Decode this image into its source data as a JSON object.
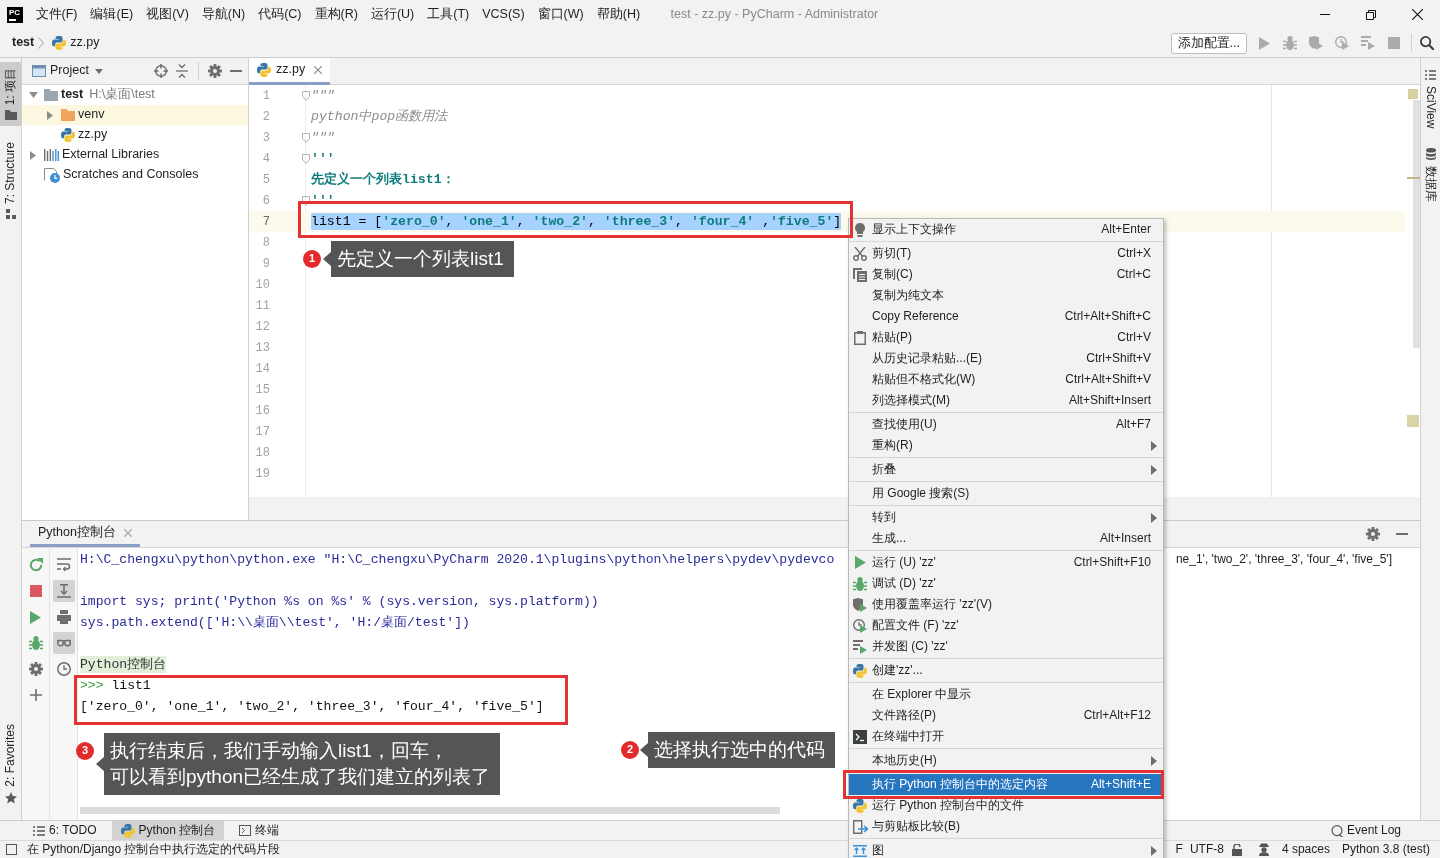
{
  "window": {
    "logo_text": "PC",
    "menu": [
      "文件(F)",
      "编辑(E)",
      "视图(V)",
      "导航(N)",
      "代码(C)",
      "重构(R)",
      "运行(U)",
      "工具(T)",
      "VCS(S)",
      "窗口(W)",
      "帮助(H)"
    ],
    "title": "test - zz.py - PyCharm - Administrator"
  },
  "navbar": {
    "breadcrumbs": [
      "test",
      "zz.py"
    ],
    "config_button": "添加配置...",
    "run_buttons_disabled": true
  },
  "left_strip": {
    "tabs": [
      {
        "label": "1: 项目",
        "selected": true
      },
      {
        "label": "7: Structure",
        "selected": false
      }
    ],
    "bottom_tabs": [
      {
        "label": "2: Favorites",
        "selected": false
      }
    ]
  },
  "project": {
    "title": "Project",
    "tree": [
      {
        "kind": "folder",
        "label": "test",
        "path": "H:\\桌面\\test",
        "expanded": true,
        "highlighted": false,
        "children": [
          {
            "kind": "excluded-folder",
            "label": "venv",
            "expanded": false,
            "highlighted": true
          },
          {
            "kind": "python-file",
            "label": "zz.py",
            "highlighted": false
          }
        ]
      },
      {
        "kind": "library",
        "label": "External Libraries",
        "expanded": false,
        "highlighted": false
      },
      {
        "kind": "scratches",
        "label": "Scratches and Consoles",
        "highlighted": false
      }
    ]
  },
  "editor": {
    "tabs": [
      {
        "label": "zz.py",
        "selected": true
      }
    ],
    "lines": [
      {
        "number": "1",
        "fold": true,
        "selected": false,
        "current": false,
        "tokens": [
          {
            "kind": "doc",
            "text": "\"\"\""
          }
        ]
      },
      {
        "number": "2",
        "fold": false,
        "selected": false,
        "current": false,
        "tokens": [
          {
            "kind": "doc",
            "text": "python中pop函数用法"
          }
        ]
      },
      {
        "number": "3",
        "fold": true,
        "selected": false,
        "current": false,
        "tokens": [
          {
            "kind": "doc",
            "text": "\"\"\""
          }
        ]
      },
      {
        "number": "4",
        "fold": true,
        "selected": false,
        "current": false,
        "tokens": [
          {
            "kind": "string",
            "text": "'''"
          }
        ]
      },
      {
        "number": "5",
        "fold": false,
        "selected": false,
        "current": false,
        "tokens": [
          {
            "kind": "string",
            "text": "先定义一个列表list1："
          }
        ]
      },
      {
        "number": "6",
        "fold": true,
        "selected": false,
        "current": false,
        "tokens": [
          {
            "kind": "string",
            "text": "'''"
          }
        ]
      },
      {
        "number": "7",
        "fold": false,
        "selected": true,
        "current": true,
        "tokens": [
          {
            "kind": "plain",
            "text": "list1 = ["
          },
          {
            "kind": "string",
            "text": "'zero_0'"
          },
          {
            "kind": "plain",
            "text": ", "
          },
          {
            "kind": "string",
            "text": "'one_1'"
          },
          {
            "kind": "plain",
            "text": ", "
          },
          {
            "kind": "string",
            "text": "'two_2'"
          },
          {
            "kind": "plain",
            "text": ", "
          },
          {
            "kind": "string",
            "text": "'three_3'"
          },
          {
            "kind": "plain",
            "text": ", "
          },
          {
            "kind": "string",
            "text": "'four_4'"
          },
          {
            "kind": "plain",
            "text": " ,"
          },
          {
            "kind": "string",
            "text": "'five_5'"
          },
          {
            "kind": "plain",
            "text": "]"
          }
        ]
      },
      {
        "number": "8",
        "fold": false,
        "selected": false,
        "current": false
      },
      {
        "number": "9",
        "fold": false,
        "selected": false,
        "current": false
      },
      {
        "number": "10",
        "fold": false,
        "selected": false,
        "current": false
      },
      {
        "number": "11",
        "fold": false,
        "selected": false,
        "current": false
      },
      {
        "number": "12",
        "fold": false,
        "selected": false,
        "current": false
      },
      {
        "number": "13",
        "fold": false,
        "selected": false,
        "current": false
      },
      {
        "number": "14",
        "fold": false,
        "selected": false,
        "current": false
      },
      {
        "number": "15",
        "fold": false,
        "selected": false,
        "current": false
      },
      {
        "number": "16",
        "fold": false,
        "selected": false,
        "current": false
      },
      {
        "number": "17",
        "fold": false,
        "selected": false,
        "current": false
      },
      {
        "number": "18",
        "fold": false,
        "selected": false,
        "current": false
      },
      {
        "number": "19",
        "fold": false,
        "selected": false,
        "current": false
      }
    ]
  },
  "context_menu": {
    "groups": [
      [
        {
          "label": "显示上下文操作",
          "shortcut": "Alt+Enter",
          "submenu": false,
          "selected": false
        }
      ],
      [
        {
          "label": "剪切(T)",
          "shortcut": "Ctrl+X",
          "submenu": false,
          "selected": false
        },
        {
          "label": "复制(C)",
          "shortcut": "Ctrl+C",
          "submenu": false,
          "selected": false
        },
        {
          "label": "复制为纯文本",
          "submenu": false,
          "selected": false
        },
        {
          "label": "Copy Reference",
          "shortcut": "Ctrl+Alt+Shift+C",
          "submenu": false,
          "selected": false
        },
        {
          "label": "粘贴(P)",
          "shortcut": "Ctrl+V",
          "submenu": false,
          "selected": false
        },
        {
          "label": "从历史记录粘贴...(E)",
          "shortcut": "Ctrl+Shift+V",
          "submenu": false,
          "selected": false
        },
        {
          "label": "粘贴但不格式化(W)",
          "shortcut": "Ctrl+Alt+Shift+V",
          "submenu": false,
          "selected": false
        },
        {
          "label": "列选择模式(M)",
          "shortcut": "Alt+Shift+Insert",
          "submenu": false,
          "selected": false
        }
      ],
      [
        {
          "label": "查找使用(U)",
          "shortcut": "Alt+F7",
          "submenu": false,
          "selected": false
        },
        {
          "label": "重构(R)",
          "submenu": true,
          "selected": false
        }
      ],
      [
        {
          "label": "折叠",
          "submenu": true,
          "selected": false
        }
      ],
      [
        {
          "label": "用 Google 搜索(S)",
          "submenu": false,
          "selected": false
        }
      ],
      [
        {
          "label": "转到",
          "submenu": true,
          "selected": false
        },
        {
          "label": "生成...",
          "shortcut": "Alt+Insert",
          "submenu": false,
          "selected": false
        }
      ],
      [
        {
          "label": "运行 (U) 'zz'",
          "shortcut": "Ctrl+Shift+F10",
          "submenu": false,
          "selected": false
        },
        {
          "label": "调试 (D) 'zz'",
          "submenu": false,
          "selected": false
        },
        {
          "label": "使用覆盖率运行 'zz'(V)",
          "submenu": false,
          "selected": false
        },
        {
          "label": "配置文件 (F) 'zz'",
          "submenu": false,
          "selected": false
        },
        {
          "label": "并发图 (C) 'zz'",
          "submenu": false,
          "selected": false
        }
      ],
      [
        {
          "label": "创建'zz'...",
          "submenu": false,
          "selected": false
        }
      ],
      [
        {
          "label": "在 Explorer 中显示",
          "submenu": false,
          "selected": false
        },
        {
          "label": "文件路径(P)",
          "shortcut": "Ctrl+Alt+F12",
          "submenu": false,
          "selected": false
        },
        {
          "label": "在终端中打开",
          "submenu": false,
          "selected": false
        }
      ],
      [
        {
          "label": "本地历史(H)",
          "submenu": true,
          "selected": false
        }
      ],
      [
        {
          "label": "执行 Python 控制台中的选定内容",
          "shortcut": "Alt+Shift+E",
          "submenu": false,
          "selected": true
        },
        {
          "label": "运行 Python 控制台中的文件",
          "submenu": false,
          "selected": false
        },
        {
          "label": "与剪贴板比较(B)",
          "submenu": false,
          "selected": false
        }
      ],
      [
        {
          "label": "图",
          "submenu": true,
          "selected": false
        }
      ]
    ]
  },
  "console": {
    "tabs": [
      {
        "label": "Python控制台",
        "selected": true
      }
    ],
    "tools": [
      {
        "on": false
      },
      {
        "on": true
      },
      {
        "on": false
      },
      {
        "on": true
      },
      {
        "on": false
      }
    ],
    "blocks": [
      [
        {
          "kind": "command",
          "text": "H:\\C_chengxu\\python\\python.exe \"H:\\C_chengxu\\PyCharm 2020.1\\plugins\\python\\helpers\\pydev\\pydevco"
        }
      ],
      [
        {
          "kind": "command",
          "text": "import sys; print('Python %s on %s' % (sys.version, sys.platform))"
        },
        {
          "kind": "command",
          "text": "sys.path.extend(['H:\\\\桌面\\\\test', 'H:/桌面/test'])"
        }
      ],
      [
        {
          "kind": "banner",
          "text": "Python控制台"
        },
        {
          "kind": "input",
          "prompt": ">>>",
          "text": "list1"
        },
        {
          "kind": "output",
          "text": "['zero_0', 'one_1', 'two_2', 'three_3', 'four_4', 'five_5']"
        }
      ]
    ],
    "partial_output": "ne_1', 'two_2', 'three_3', 'four_4', 'five_5']"
  },
  "tool_tabs": {
    "left": [
      {
        "label": "6: TODO",
        "selected": false
      },
      {
        "label": "Python 控制台",
        "selected": true
      },
      {
        "label": "终端",
        "selected": false
      }
    ],
    "right": [
      {
        "label": "Event Log",
        "selected": false
      }
    ]
  },
  "status_bar": {
    "message": "在 Python/Django 控制台中执行选定的代码片段",
    "items": [
      "F",
      "UTF-8",
      "4 spaces",
      "Python 3.8 (test)"
    ]
  },
  "right_strip": {
    "tabs": [
      {
        "label": "SciView",
        "selected": false
      },
      {
        "label": "数据库",
        "selected": false
      }
    ]
  },
  "annotations": [
    {
      "number": "1",
      "lines": [
        "先定义一个列表list1"
      ]
    },
    {
      "number": "3",
      "lines": [
        "执行结束后，我们手动输入list1，回车，",
        "可以看到python已经生成了我们建立的列表了"
      ]
    },
    {
      "number": "2",
      "lines": [
        "选择执行选中的代码"
      ]
    }
  ]
}
